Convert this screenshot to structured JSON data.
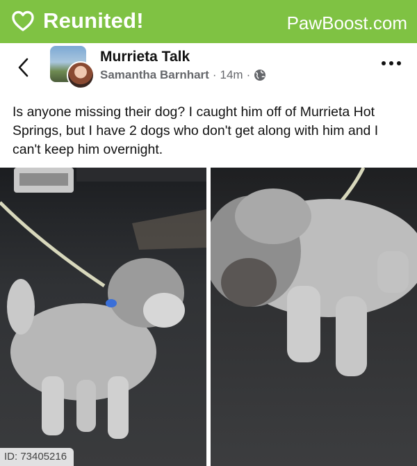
{
  "banner": {
    "title": "Reunited!",
    "brand": "PawBoost.com",
    "icon": "heart-outline-icon",
    "color": "#7fc243"
  },
  "post": {
    "group_name": "Murrieta Talk",
    "author": "Samantha Barnhart",
    "time": "14m",
    "separator": "·",
    "text": "Is anyone missing their dog? I caught him off of Murrieta Hot Springs, but I have 2 dogs who don't get along with him and I can't keep him overnight."
  },
  "icons": {
    "back": "chevron-left-icon",
    "more": "more-horizontal-icon",
    "privacy": "globe-icon"
  },
  "photos": [
    {
      "name": "dog-photo-left",
      "description_hidden": ""
    },
    {
      "name": "dog-photo-right",
      "description_hidden": ""
    }
  ],
  "badge": {
    "id_text": "ID: 73405216"
  }
}
